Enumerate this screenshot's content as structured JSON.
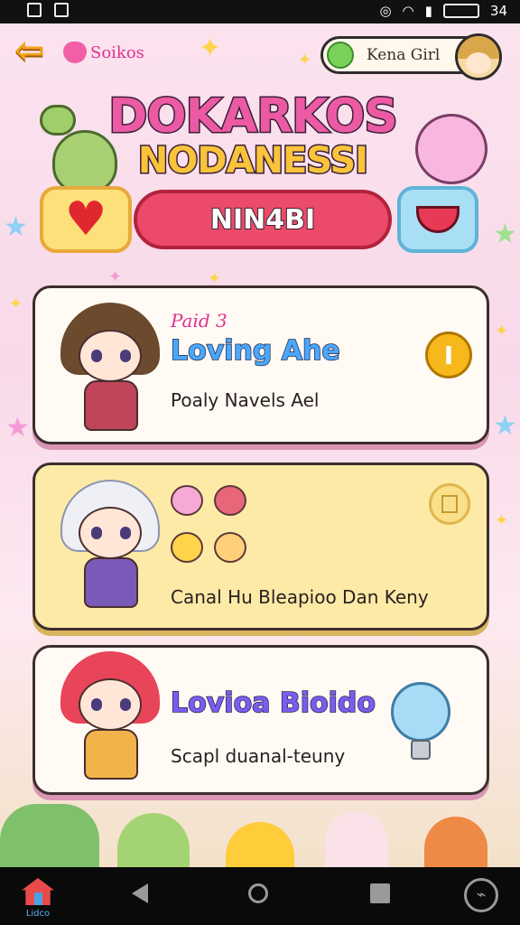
{
  "status_bar": {
    "time": "34"
  },
  "header": {
    "coins_label": "Soikos",
    "user_name": "Kena Girl"
  },
  "title": {
    "line1": "DOKARKOS",
    "line2": "NODANESSI"
  },
  "tabs": {
    "main_label": "NIN4BI"
  },
  "cards": [
    {
      "tag": "Paid 3",
      "title": "Loving Ahe",
      "subtitle": "Poaly Navels Ael",
      "action_glyph": "I",
      "colors": {
        "hair": "#6b4a2e",
        "outfit": "#c0445a"
      }
    },
    {
      "tag": "",
      "title": "",
      "subtitle": "Canal Hu Bleapioo Dan Keny",
      "action_glyph": "",
      "colors": {
        "hair": "#eef0f6",
        "outfit": "#7a5ab8"
      }
    },
    {
      "tag": "",
      "title": "Lovioa Bioido",
      "subtitle": "Scapl duanal-teuny",
      "action_glyph": "",
      "colors": {
        "hair": "#e8445a",
        "outfit": "#f1b24a"
      }
    }
  ],
  "nav": {
    "home_label": "Lidco"
  },
  "theme": {
    "accent_pink": "#ec4a6a",
    "accent_yellow": "#fde07a",
    "accent_blue": "#a9dff5"
  },
  "icons": [
    "back-arrow-icon",
    "heart-icon",
    "user-badge-icon",
    "coin-icon",
    "slot-icon",
    "lightbulb-icon",
    "home-icon",
    "back-triangle-icon",
    "home-circle-icon",
    "recent-apps-icon",
    "assistant-icon"
  ]
}
